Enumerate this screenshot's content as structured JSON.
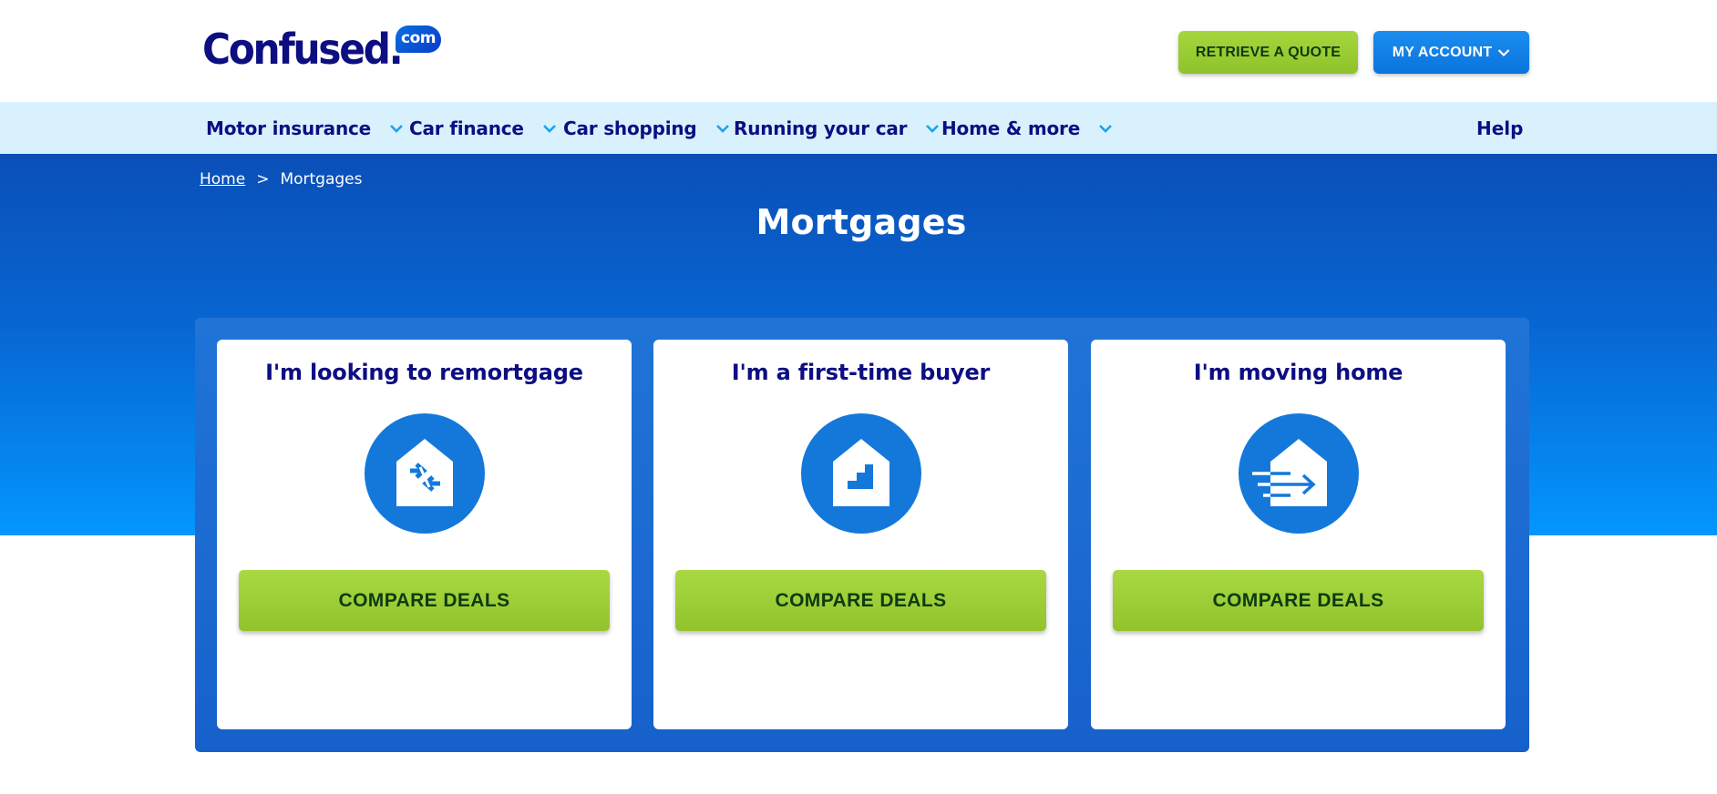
{
  "header": {
    "logo_text": "Confused.",
    "logo_badge": "com",
    "retrieve_quote_label": "RETRIEVE A QUOTE",
    "my_account_label": "MY ACCOUNT"
  },
  "nav": {
    "items": [
      {
        "label": "Motor insurance",
        "icon": "chevron-down-icon"
      },
      {
        "label": "Car finance",
        "icon": "chevron-down-icon"
      },
      {
        "label": "Car shopping",
        "icon": "chevron-down-icon"
      },
      {
        "label": "Running your car",
        "icon": "chevron-down-icon"
      },
      {
        "label": "Home & more",
        "icon": "chevron-down-icon"
      }
    ],
    "help_label": "Help"
  },
  "breadcrumb": {
    "home_label": "Home",
    "separator": ">",
    "current_label": "Mortgages"
  },
  "page": {
    "title": "Mortgages"
  },
  "cards": [
    {
      "title": "I'm looking to remortgage",
      "icon": "house-swap-arrows-icon",
      "button_label": "COMPARE DEALS"
    },
    {
      "title": "I'm a first-time buyer",
      "icon": "house-stairs-icon",
      "button_label": "COMPARE DEALS"
    },
    {
      "title": "I'm moving home",
      "icon": "house-moving-arrow-icon",
      "button_label": "COMPARE DEALS"
    }
  ],
  "colors": {
    "brand_navy": "#0c0e82",
    "brand_blue": "#0a74dd",
    "accent_green": "#9ccf35",
    "nav_background": "#d9f1fd",
    "icon_blue": "#1478da"
  }
}
